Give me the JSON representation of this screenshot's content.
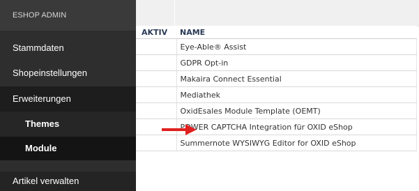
{
  "sidebar": {
    "header": "ESHOP ADMIN",
    "items": [
      {
        "label": "Stammdaten"
      },
      {
        "label": "Shopeinstellungen"
      },
      {
        "label": "Erweiterungen"
      },
      {
        "label": "Themes"
      },
      {
        "label": "Module"
      },
      {
        "label": "Artikel verwalten"
      }
    ]
  },
  "table": {
    "headers": {
      "active": "AKTIV",
      "name": "NAME"
    },
    "rows": [
      {
        "active": "",
        "name": "Eye-Able® Assist"
      },
      {
        "active": "",
        "name": "GDPR Opt-in"
      },
      {
        "active": "",
        "name": "Makaira Connect Essential"
      },
      {
        "active": "",
        "name": "Mediathek"
      },
      {
        "active": "",
        "name": "OxidEsales Module Template (OEMT)"
      },
      {
        "active": "",
        "name": "POWER CAPTCHA Integration für OXID eShop"
      },
      {
        "active": "",
        "name": "Summernote WYSIWYG Editor for OXID eShop"
      }
    ]
  },
  "annotation": {
    "arrow_color": "#e02020",
    "arrow_icon": "red-right-arrow-icon"
  },
  "colors": {
    "sidebar_bg": "#2e2e2e",
    "active_menu_bg": "#141414",
    "header_text": "#2a3b55"
  }
}
